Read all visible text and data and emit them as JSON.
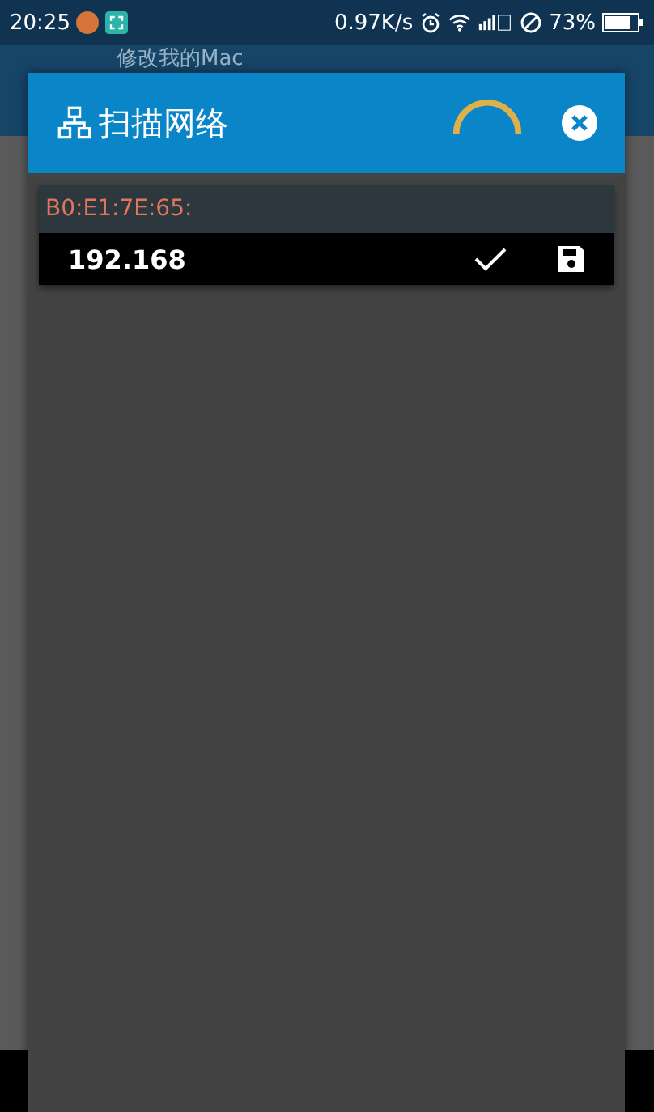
{
  "status_bar": {
    "time": "20:25",
    "speed": "0.97K/s",
    "battery_percent": "73%"
  },
  "app_bar": {
    "title": "修改我的Mac"
  },
  "dialog": {
    "title": "扫描网络",
    "loading": true,
    "devices": [
      {
        "mac": "B0:E1:7E:65:",
        "ip": "192.168",
        "checked": true
      }
    ]
  }
}
